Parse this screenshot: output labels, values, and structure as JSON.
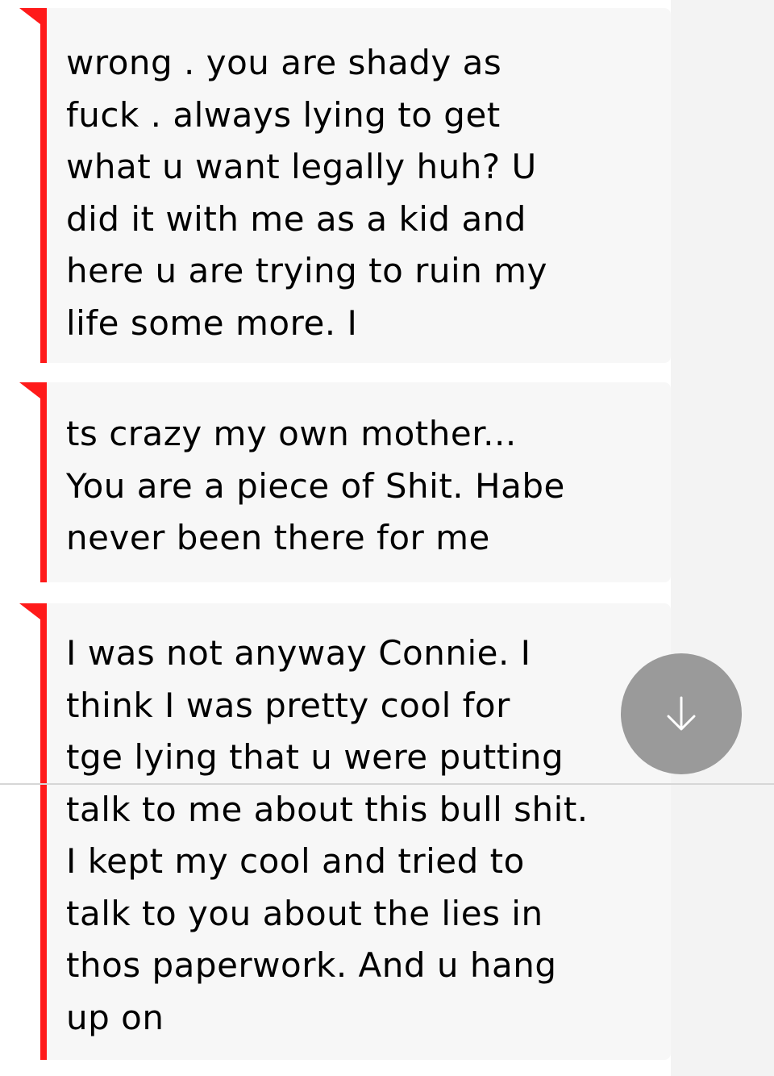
{
  "messages": [
    {
      "text": "wrong . you are shady as\nfuck . always lying to get\nwhat u want legally huh? U\ndid it with me as a kid and\nhere u are trying to ruin my\nlife some more. I"
    },
    {
      "text": "ts crazy my own mother...\nYou are a piece of Shit. Habe\nnever been there for me"
    },
    {
      "text": "I was not anyway Connie. I\nthink I was pretty cool for\ntge lying that u were putting\ntalk to me about this bull shit.\nI kept my cool and tried to\ntalk to you about the lies in\nthos paperwork. And u hang\nup on"
    }
  ],
  "scroll_button": {
    "icon": "arrow-down-icon"
  },
  "colors": {
    "accent_bar": "#ff1a1a",
    "bubble_bg": "#f7f7f7",
    "fab_bg": "#9a9a9a"
  }
}
